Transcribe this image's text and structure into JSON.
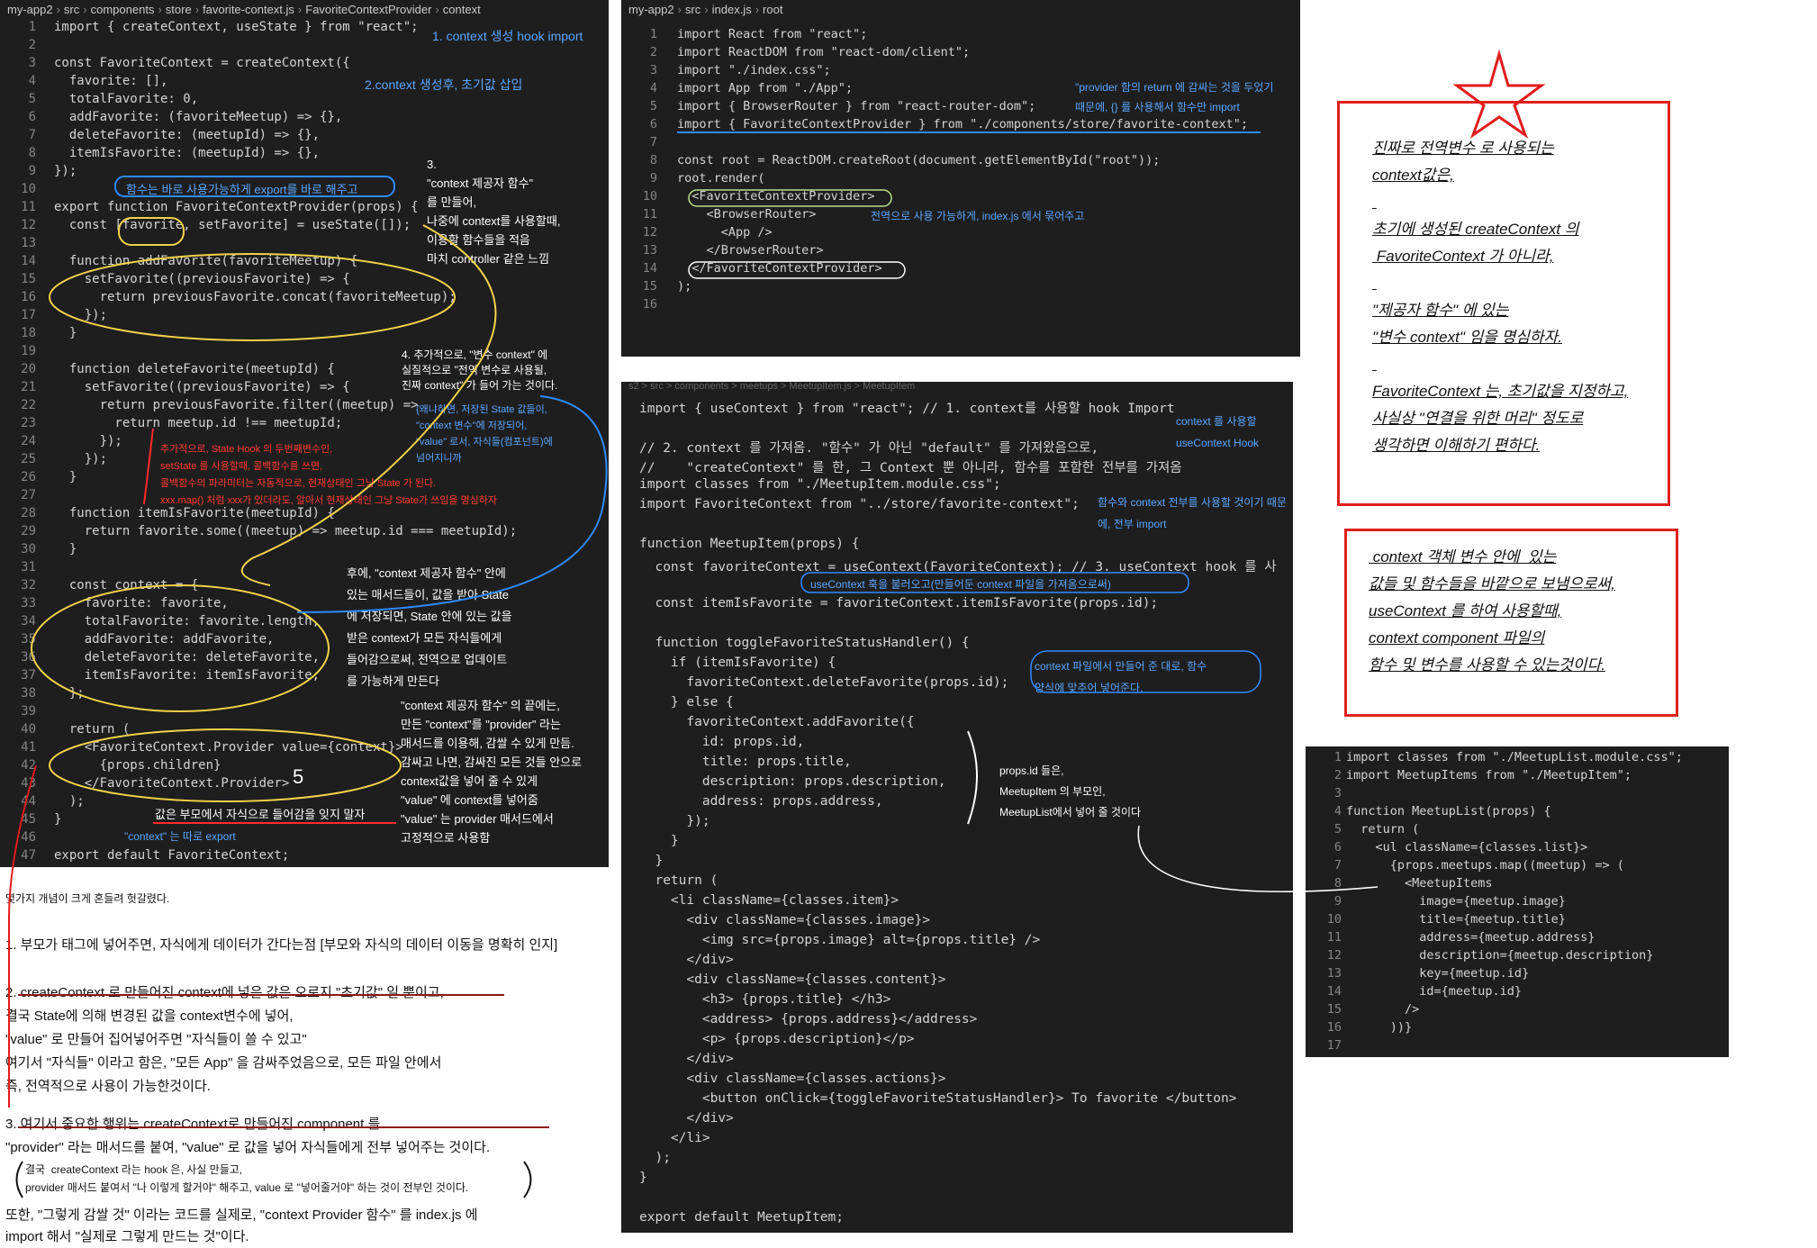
{
  "panel1": {
    "breadcrumb": [
      "my-app2",
      "src",
      "components",
      "store",
      "favorite-context.js",
      "FavoriteContextProvider",
      "context"
    ],
    "lines": [
      "import { createContext, useState } from \"react\";",
      "",
      "const FavoriteContext = createContext({",
      "  favorite: [],",
      "  totalFavorite: 0,",
      "  addFavorite: (favoriteMeetup) => {},",
      "  deleteFavorite: (meetupId) => {},",
      "  itemIsFavorite: (meetupId) => {},",
      "});",
      "",
      "export function FavoriteContextProvider(props) {",
      "  const [favorite, setFavorite] = useState([]);",
      "",
      "  function addFavorite(favoriteMeetup) {",
      "    setFavorite((previousFavorite) => {",
      "      return previousFavorite.concat(favoriteMeetup);",
      "    });",
      "  }",
      "",
      "  function deleteFavorite(meetupId) {",
      "    setFavorite((previousFavorite) => {",
      "      return previousFavorite.filter((meetup) =>",
      "        return meetup.id !== meetupId;",
      "      });",
      "    });",
      "  }",
      "",
      "  function itemIsFavorite(meetupId) {",
      "    return favorite.some((meetup) => meetup.id === meetupId);",
      "  }",
      "",
      "  const context = {",
      "    favorite: favorite,",
      "    totalFavorite: favorite.length,",
      "    addFavorite: addFavorite,",
      "    deleteFavorite: deleteFavorite,",
      "    itemIsFavorite: itemIsFavorite,",
      "  };",
      "",
      "  return (",
      "    <FavoriteContext.Provider value={context}>",
      "      {props.children}",
      "    </FavoriteContext.Provider>",
      "  );",
      "}",
      "",
      "export default FavoriteContext;"
    ],
    "annotations": {
      "a1": "1. context 생성 hook import",
      "a2": "2.context 생성후, 초기값 삽입",
      "a3": "3.\n\"context 제공자 함수\"\n를 만들어,\n나중에 context를 사용할때,\n이용할 함수들을 적음\n마치 controller 같은 느낌",
      "a4": "함수는 바로 사용가능하게 export를 바로 해주고",
      "a5": "4. 추가적으로, \"변수 context\" 에\n실질적으로 \"전역 변수로 사용될,\n진짜 context\" 가 들어 가는 것이다.",
      "a6": "{왜냐하면, 저장된 State 값들이,\n\"context 변수\"에 저장되어,\n\"value\" 로서, 자식들(컴포넌트)에\n넘어지니까",
      "a7": "추가적으로, State Hook 의 두번째변수인,\nsetState 를 사용할때, 콜백함수를 쓰면,\n콜백함수의 파라미터는 자동적으로, 현재상태인 그냥 State 가 된다.\nxxx.map() 처럼 xxx가 있더라도, 알아서 현재상태인 그냥 State가 쓰임을 명심하자",
      "a8": "후에, \"context 제공자 함수\" 안에\n있는 매서드들이, 값을 받아 State\n에 저장되면, State 안에 있는 값을\n받은 context가 모든 자식들에게\n들어감으로써, 전역으로 업데이트\n를 가능하게 만든다",
      "a9": "\"context 제공자 함수\" 의 끝에는,\n만든 \"context\"를 \"provider\" 라는\n매서드를 이용해, 감쌀 수 있게 만듬.\n감싸고 나면, 감싸진 모든 것들 안으로\ncontext값을 넣어 줄 수 있게\n\"value\" 에 context를 넣어줌\n\"value\" 는 provider 매서드에서\n고정적으로 사용함",
      "a10": "값은 부모에서 자식으로 들어감을 잊지 말자",
      "a11": "\"context\" 는 따로 export",
      "a12": "5"
    }
  },
  "panel2": {
    "breadcrumb": [
      "my-app2",
      "src",
      "index.js",
      "root"
    ],
    "lines": [
      "import React from \"react\";",
      "import ReactDOM from \"react-dom/client\";",
      "import \"./index.css\";",
      "import App from \"./App\";",
      "import { BrowserRouter } from \"react-router-dom\";",
      "import { FavoriteContextProvider } from \"./components/store/favorite-context\";",
      "",
      "const root = ReactDOM.createRoot(document.getElementById(\"root\"));",
      "root.render(",
      "  <FavoriteContextProvider>",
      "    <BrowserRouter>",
      "      <App />",
      "    </BrowserRouter>",
      "  </FavoriteContextProvider>",
      ");",
      ""
    ],
    "annotations": {
      "b1": "\"provider 함의 return 에 감싸는 것을 두었기\n때문에, {} 를 사용해서 함수만 import",
      "b2": "전역으로 사용 가능하게, index.js 에서 묶어주고"
    }
  },
  "panel3": {
    "breadcrumb": "s2 > src > components > meetups > MeetupItem.js > MeetupItem",
    "lines": [
      "import { useContext } from \"react\"; // 1. context를 사용할 hook Import",
      "",
      "// 2. context 를 가져옴. \"함수\" 가 아닌 \"default\" 를 가져왔음으로,",
      "//    \"createContext\" 를 한, 그 Context 뿐 아니라, 함수를 포함한 전부를 가져옴",
      "import classes from \"./MeetupItem.module.css\";",
      "import FavoriteContext from \"../store/favorite-context\";",
      "",
      "function MeetupItem(props) {",
      "  const favoriteContext = useContext(FavoriteContext); // 3. useContext hook 를 사",
      "",
      "  const itemIsFavorite = favoriteContext.itemIsFavorite(props.id);",
      "",
      "  function toggleFavoriteStatusHandler() {",
      "    if (itemIsFavorite) {",
      "      favoriteContext.deleteFavorite(props.id);",
      "    } else {",
      "      favoriteContext.addFavorite({",
      "        id: props.id,",
      "        title: props.title,",
      "        description: props.description,",
      "        address: props.address,",
      "      });",
      "    }",
      "  }",
      "  return (",
      "    <li className={classes.item}>",
      "      <div className={classes.image}>",
      "        <img src={props.image} alt={props.title} />",
      "      </div>",
      "      <div className={classes.content}>",
      "        <h3> {props.title} </h3>",
      "        <address> {props.address}</address>",
      "        <p> {props.description}</p>",
      "      </div>",
      "      <div className={classes.actions}>",
      "        <button onClick={toggleFavoriteStatusHandler}> To favorite </button>",
      "      </div>",
      "    </li>",
      "  );",
      "}",
      "",
      "export default MeetupItem;"
    ],
    "annotations": {
      "c1": "context 를 사용할\nuseContext Hook",
      "c2": "함수와 context 전부를 사용할 것이기 때문\n에, 전부 import",
      "c3": "useContext 훅을 불러오고(만들어둔 context 파일을 가져옴으로써)",
      "c4": "context 파일에서 만들어 준 대로, 함수\n양식에 맞추어 넣어준다.",
      "c5": "props.id 들은,\nMeetupItem 의 부모인,\nMeetupList에서 넣어 줄 것이다"
    }
  },
  "panel4": {
    "lines": [
      "import classes from \"./MeetupList.module.css\";",
      "import MeetupItems from \"./MeetupItem\";",
      "",
      "function MeetupList(props) {",
      "  return (",
      "    <ul className={classes.list}>",
      "      {props.meetups.map((meetup) => (",
      "        <MeetupItems",
      "          image={meetup.image}",
      "          title={meetup.title}",
      "          address={meetup.address}",
      "          description={meetup.description}",
      "          key={meetup.id}",
      "          id={meetup.id}",
      "        />",
      "      ))}",
      ""
    ]
  },
  "box1": {
    "lines": [
      "진짜로 전역변수 로 사용되는",
      "context값은,",
      "",
      "초기에 생성된 createContext 의",
      " FavoriteContext 가 아니라,",
      "",
      "\"제공자 함수\" 에 있는",
      "\"변수 context\" 임을 명심하자.",
      "",
      "FavoriteContext 는, 초기값을 지정하고,",
      "사실상 \"연결을 위한 머리\" 정도로",
      "생각하면 이해하기 편하다."
    ]
  },
  "box2": {
    "lines": [
      " context 객체 변수 안에  있는",
      "값들 및 함수들을 바깥으로 보냄으로써,",
      "useContext 를 하여 사용할때,",
      "context component 파일의",
      "함수 및 변수를 사용할 수 있는것이다."
    ]
  },
  "notes": {
    "n0": "몇가지 개념이 크게 혼들려 헛갈렸다.",
    "n1": "1. 부모가 태그에 넣어주면, 자식에게 데이터가 간다는점 [부모와 자식의 데이터 이동을 명확히 인지]",
    "n2": "2. createContext 로 만들어진 context에 넣은 값은 오로지 \"초기값\" 일 뿐이고,\n결국 State에 의해 변경된 값을 context변수에 넣어,\n\"value\" 로 만들어 집어넣어주면 \"자식들이 쓸 수 있고\"\n여기서 \"자식들\" 이라고 함은, \"모든 App\" 을 감싸주었음으로, 모든 파일 안에서\n즉, 전역적으로 사용이 가능한것이다.",
    "n3": "3. 여기서 중요한 행위는 createContext로 만들어진 component 를\n\"provider\" 라는 매서드를 붙여, \"value\" 로 값을 넣어 자식들에게 전부 넣어주는 것이다.",
    "n4": "결국  createContext 라는 hook 은, 사실 만들고,\nprovider 매서드 붙여서 \"나 이렇게 할거야\" 해주고, value 로 \"넣어줄거야\" 하는 것이 전부인 것이다.",
    "n5": "또한, \"그렇게 감쌀 것\" 이라는 코드를 실제로, \"context Provider 함수\" 를 index.js 에\nimport 해서 \"실제로 그렇게 만드는 것\"이다."
  }
}
